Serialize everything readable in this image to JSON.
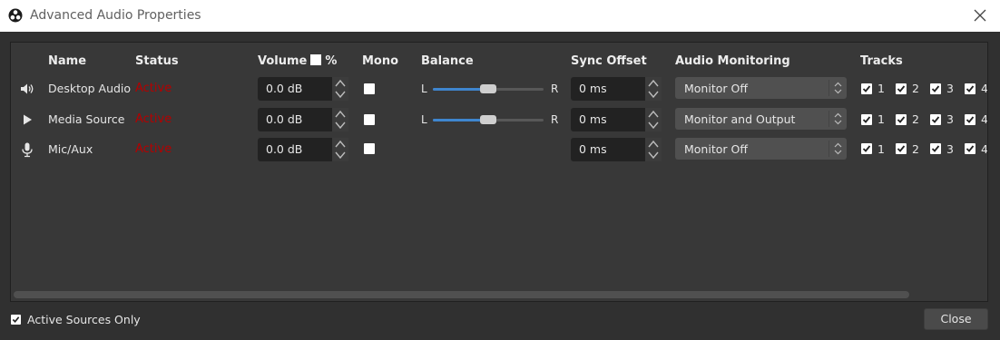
{
  "window": {
    "title": "Advanced Audio Properties",
    "app_icon": "obs-logo-icon",
    "close_icon": "close-icon"
  },
  "columns": {
    "name": "Name",
    "status": "Status",
    "volume": "Volume",
    "volume_unit": "%",
    "mono": "Mono",
    "balance": "Balance",
    "sync_offset": "Sync Offset",
    "audio_monitoring": "Audio Monitoring",
    "tracks": "Tracks"
  },
  "balance_left": "L",
  "balance_right": "R",
  "rows": [
    {
      "icon": "speaker-icon",
      "name": "Desktop Audio",
      "status": "Active",
      "volume": "0.0 dB",
      "mono": false,
      "balance": 0.5,
      "has_balance": true,
      "sync_offset": "0 ms",
      "monitoring": "Monitor Off",
      "tracks": [
        "1",
        "2",
        "3",
        "4"
      ]
    },
    {
      "icon": "play-icon",
      "name": "Media Source",
      "status": "Active",
      "volume": "0.0 dB",
      "mono": false,
      "balance": 0.5,
      "has_balance": true,
      "sync_offset": "0 ms",
      "monitoring": "Monitor and Output",
      "tracks": [
        "1",
        "2",
        "3",
        "4"
      ]
    },
    {
      "icon": "microphone-icon",
      "name": "Mic/Aux",
      "status": "Active",
      "volume": "0.0 dB",
      "mono": false,
      "has_balance": false,
      "sync_offset": "0 ms",
      "monitoring": "Monitor Off",
      "tracks": [
        "1",
        "2",
        "3",
        "4"
      ]
    }
  ],
  "footer": {
    "active_sources_only": "Active Sources Only",
    "active_sources_checked": true,
    "close_button": "Close"
  },
  "colors": {
    "background": "#303030",
    "panel": "#383838",
    "status_active": "#b40000",
    "slider_fill": "#3f86cf"
  }
}
